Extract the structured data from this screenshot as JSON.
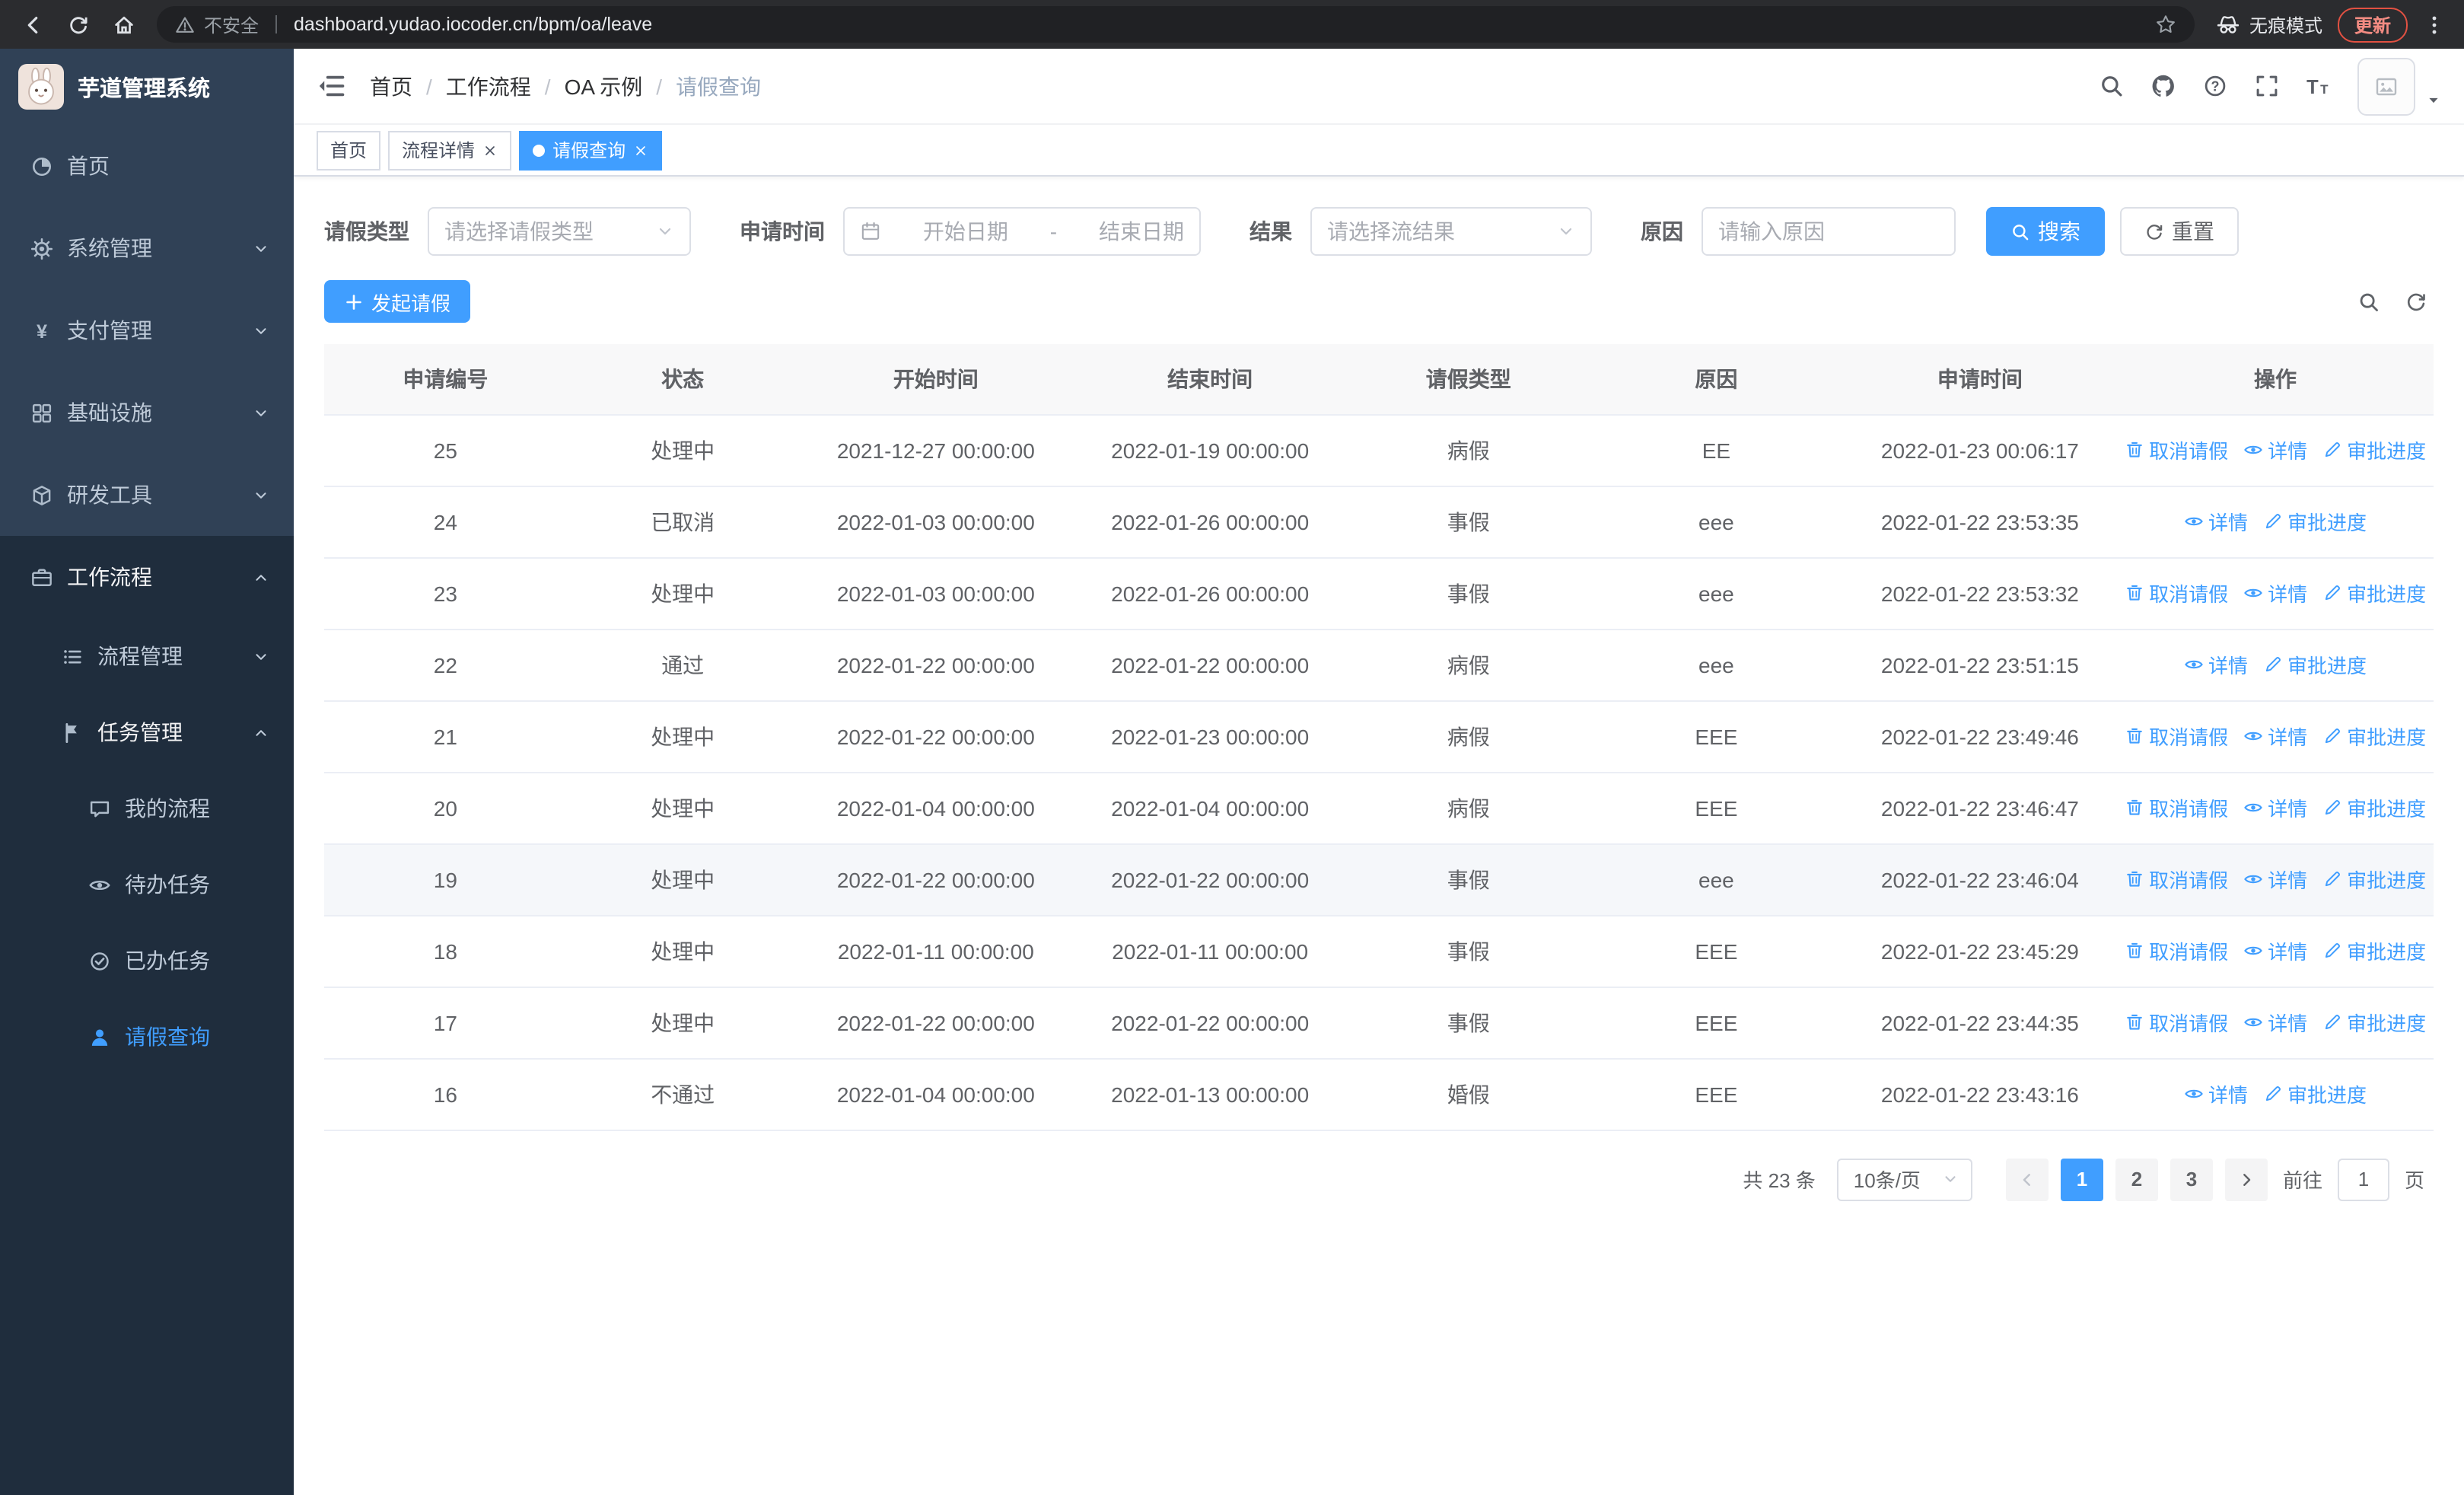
{
  "browser": {
    "security_label": "不安全",
    "url": "dashboard.yudao.iocoder.cn/bpm/oa/leave",
    "incognito_label": "无痕模式",
    "update_label": "更新"
  },
  "sidebar": {
    "logo_title": "芋道管理系统",
    "menu": [
      {
        "label": "首页",
        "icon": "dashboard-icon",
        "level": 1
      },
      {
        "label": "系统管理",
        "icon": "gear-icon",
        "level": 1,
        "arrow": "chevron-down-icon"
      },
      {
        "label": "支付管理",
        "icon": "yen-icon",
        "level": 1,
        "arrow": "chevron-down-icon"
      },
      {
        "label": "基础设施",
        "icon": "grid-icon",
        "level": 1,
        "arrow": "chevron-down-icon"
      },
      {
        "label": "研发工具",
        "icon": "cube-icon",
        "level": 1,
        "arrow": "chevron-down-icon"
      },
      {
        "label": "工作流程",
        "icon": "briefcase-icon",
        "level": 1,
        "arrow": "chevron-up-icon",
        "open": true
      },
      {
        "label": "流程管理",
        "icon": "list-icon",
        "level": 2,
        "arrow": "chevron-down-icon"
      },
      {
        "label": "任务管理",
        "icon": "flag-icon",
        "level": 2,
        "arrow": "chevron-up-icon",
        "open": true
      },
      {
        "label": "我的流程",
        "icon": "chat-icon",
        "level": 3
      },
      {
        "label": "待办任务",
        "icon": "eye-icon",
        "level": 3
      },
      {
        "label": "已办任务",
        "icon": "check-circle-icon",
        "level": 3
      },
      {
        "label": "请假查询",
        "icon": "user-icon",
        "level": 3,
        "active": true
      }
    ]
  },
  "header": {
    "breadcrumb": [
      "首页",
      "工作流程",
      "OA 示例",
      "请假查询"
    ],
    "breadcrumb_separator": "/"
  },
  "tabs": [
    {
      "label": "首页",
      "closable": false,
      "active": false
    },
    {
      "label": "流程详情",
      "closable": true,
      "active": false
    },
    {
      "label": "请假查询",
      "closable": true,
      "active": true
    }
  ],
  "filters": {
    "leave_type_label": "请假类型",
    "leave_type_placeholder": "请选择请假类型",
    "apply_time_label": "申请时间",
    "start_placeholder": "开始日期",
    "range_separator": "-",
    "end_placeholder": "结束日期",
    "result_label": "结果",
    "result_placeholder": "请选择流结果",
    "reason_label": "原因",
    "reason_placeholder": "请输入原因",
    "search_label": "搜索",
    "reset_label": "重置"
  },
  "toolbar": {
    "create_label": "发起请假"
  },
  "table": {
    "columns": [
      "申请编号",
      "状态",
      "开始时间",
      "结束时间",
      "请假类型",
      "原因",
      "申请时间",
      "操作"
    ],
    "action_defs": {
      "cancel": {
        "label": "取消请假",
        "icon": "delete-icon"
      },
      "detail": {
        "label": "详情",
        "icon": "eye-icon"
      },
      "progress": {
        "label": "审批进度",
        "icon": "edit-icon"
      }
    },
    "rows": [
      {
        "id": "25",
        "status": "处理中",
        "start": "2021-12-27 00:00:00",
        "end": "2022-01-19 00:00:00",
        "type": "病假",
        "reason": "EE",
        "applied": "2022-01-23 00:06:17",
        "actions": [
          "cancel",
          "detail",
          "progress"
        ]
      },
      {
        "id": "24",
        "status": "已取消",
        "start": "2022-01-03 00:00:00",
        "end": "2022-01-26 00:00:00",
        "type": "事假",
        "reason": "eee",
        "applied": "2022-01-22 23:53:35",
        "actions": [
          "detail",
          "progress"
        ]
      },
      {
        "id": "23",
        "status": "处理中",
        "start": "2022-01-03 00:00:00",
        "end": "2022-01-26 00:00:00",
        "type": "事假",
        "reason": "eee",
        "applied": "2022-01-22 23:53:32",
        "actions": [
          "cancel",
          "detail",
          "progress"
        ]
      },
      {
        "id": "22",
        "status": "通过",
        "start": "2022-01-22 00:00:00",
        "end": "2022-01-22 00:00:00",
        "type": "病假",
        "reason": "eee",
        "applied": "2022-01-22 23:51:15",
        "actions": [
          "detail",
          "progress"
        ]
      },
      {
        "id": "21",
        "status": "处理中",
        "start": "2022-01-22 00:00:00",
        "end": "2022-01-23 00:00:00",
        "type": "病假",
        "reason": "EEE",
        "applied": "2022-01-22 23:49:46",
        "actions": [
          "cancel",
          "detail",
          "progress"
        ]
      },
      {
        "id": "20",
        "status": "处理中",
        "start": "2022-01-04 00:00:00",
        "end": "2022-01-04 00:00:00",
        "type": "病假",
        "reason": "EEE",
        "applied": "2022-01-22 23:46:47",
        "actions": [
          "cancel",
          "detail",
          "progress"
        ]
      },
      {
        "id": "19",
        "status": "处理中",
        "start": "2022-01-22 00:00:00",
        "end": "2022-01-22 00:00:00",
        "type": "事假",
        "reason": "eee",
        "applied": "2022-01-22 23:46:04",
        "actions": [
          "cancel",
          "detail",
          "progress"
        ],
        "hover": true
      },
      {
        "id": "18",
        "status": "处理中",
        "start": "2022-01-11 00:00:00",
        "end": "2022-01-11 00:00:00",
        "type": "事假",
        "reason": "EEE",
        "applied": "2022-01-22 23:45:29",
        "actions": [
          "cancel",
          "detail",
          "progress"
        ]
      },
      {
        "id": "17",
        "status": "处理中",
        "start": "2022-01-22 00:00:00",
        "end": "2022-01-22 00:00:00",
        "type": "事假",
        "reason": "EEE",
        "applied": "2022-01-22 23:44:35",
        "actions": [
          "cancel",
          "detail",
          "progress"
        ]
      },
      {
        "id": "16",
        "status": "不通过",
        "start": "2022-01-04 00:00:00",
        "end": "2022-01-13 00:00:00",
        "type": "婚假",
        "reason": "EEE",
        "applied": "2022-01-22 23:43:16",
        "actions": [
          "detail",
          "progress"
        ]
      }
    ]
  },
  "pagination": {
    "total_label": "共 23 条",
    "page_size_label": "10条/页",
    "pages": [
      "1",
      "2",
      "3"
    ],
    "active_page": "1",
    "jump_prefix": "前往",
    "jump_value": "1",
    "jump_suffix": "页"
  },
  "colors": {
    "accent": "#409eff",
    "sidebar_bg": "#304156",
    "submenu_bg": "#1f2d3d"
  }
}
